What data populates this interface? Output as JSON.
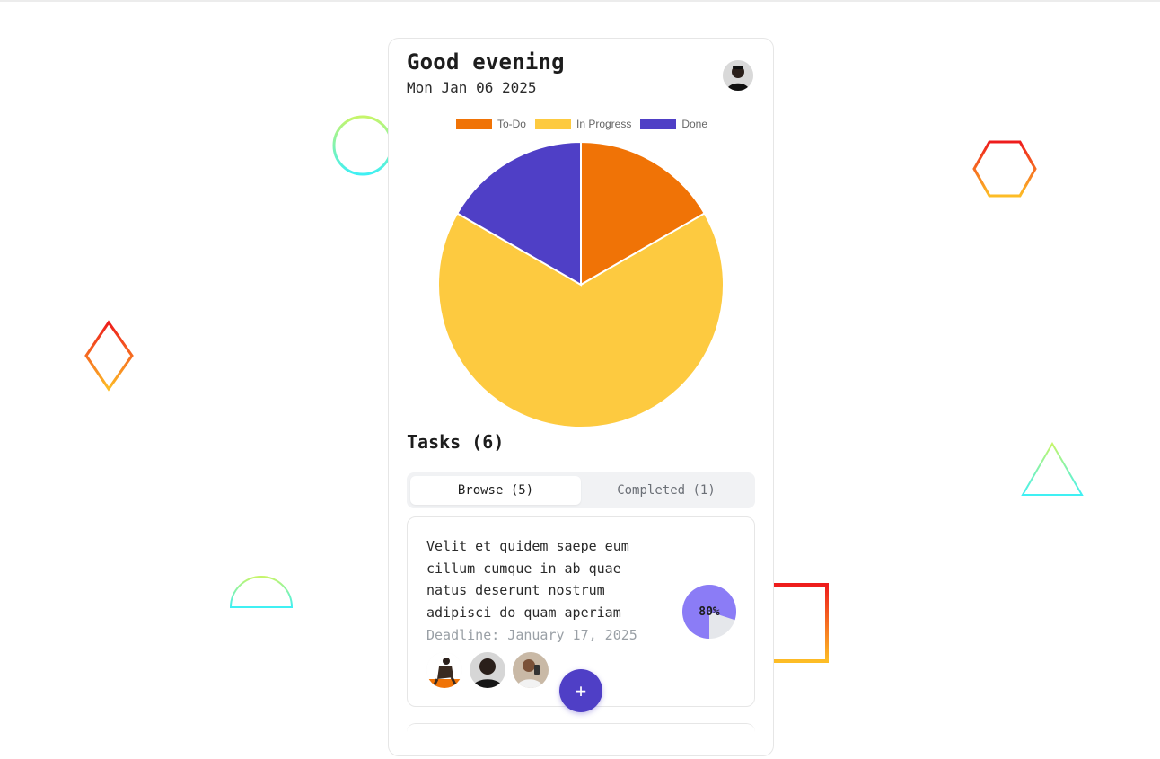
{
  "header": {
    "greeting": "Good evening",
    "date": "Mon Jan 06 2025"
  },
  "colors": {
    "todo": "#f07306",
    "in_progress": "#fdca40",
    "done": "#4f3fc6",
    "progress_fill": "#8b7cf6",
    "progress_track": "#e5e7eb"
  },
  "chart_data": {
    "type": "pie",
    "legend_position": "top",
    "categories": [
      "To-Do",
      "In Progress",
      "Done"
    ],
    "values": [
      1,
      4,
      1
    ],
    "colors": [
      "#f07306",
      "#fdca40",
      "#4f3fc6"
    ]
  },
  "tasks": {
    "title": "Tasks (6)",
    "tabs": [
      {
        "label": "Browse (5)",
        "active": true
      },
      {
        "label": "Completed (1)",
        "active": false
      }
    ],
    "items": [
      {
        "description": "Velit et quidem saepe eum cillum cumque in ab quae natus deserunt nostrum adipisci do quam aperiam",
        "deadline": "Deadline: January 17, 2025",
        "progress": 80,
        "progress_label": "80%"
      }
    ]
  },
  "fab": {
    "label": "+",
    "icon": "plus-icon"
  }
}
